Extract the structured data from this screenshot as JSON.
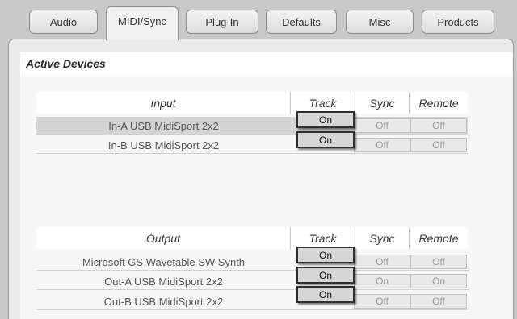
{
  "tabs": [
    {
      "label": "Audio"
    },
    {
      "label": "MIDI/Sync"
    },
    {
      "label": "Plug-In"
    },
    {
      "label": "Defaults"
    },
    {
      "label": "Misc"
    },
    {
      "label": "Products"
    }
  ],
  "section_title": "Active Devices",
  "input": {
    "headers": {
      "device": "Input",
      "track": "Track",
      "sync": "Sync",
      "remote": "Remote"
    },
    "rows": [
      {
        "device": "In-A USB MidiSport 2x2",
        "track": "On",
        "sync": "Off",
        "remote": "Off"
      },
      {
        "device": "In-B USB MidiSport 2x2",
        "track": "On",
        "sync": "Off",
        "remote": "Off"
      }
    ]
  },
  "output": {
    "headers": {
      "device": "Output",
      "track": "Track",
      "sync": "Sync",
      "remote": "Remote"
    },
    "rows": [
      {
        "device": "Microsoft GS Wavetable SW Synth",
        "track": "On",
        "sync": "Off",
        "remote": "Off"
      },
      {
        "device": "Out-A USB MidiSport 2x2",
        "track": "On",
        "sync": "On",
        "remote": "On"
      },
      {
        "device": "Out-B USB MidiSport 2x2",
        "track": "On",
        "sync": "Off",
        "remote": "Off"
      }
    ]
  }
}
